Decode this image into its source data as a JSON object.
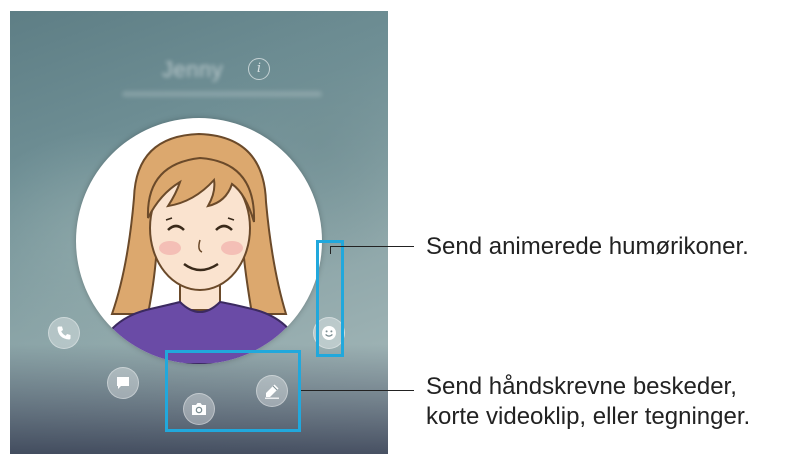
{
  "contact": {
    "name": "Jenny",
    "info_icon_glyph": "i"
  },
  "icons": {
    "call": "phone-icon",
    "message": "chat-bubble-icon",
    "camera": "camera-icon",
    "handwriting": "pencil-icon",
    "emoji": "smiley-icon"
  },
  "colors": {
    "highlight": "#21a8dc",
    "shirt": "#6a4ba6",
    "hair": "#d9a46a"
  },
  "callouts": {
    "emoji_text": "Send animerede humørikoner.",
    "handwriting_line1": "Send håndskrevne beskeder,",
    "handwriting_line2": "korte videoklip, eller tegninger."
  }
}
